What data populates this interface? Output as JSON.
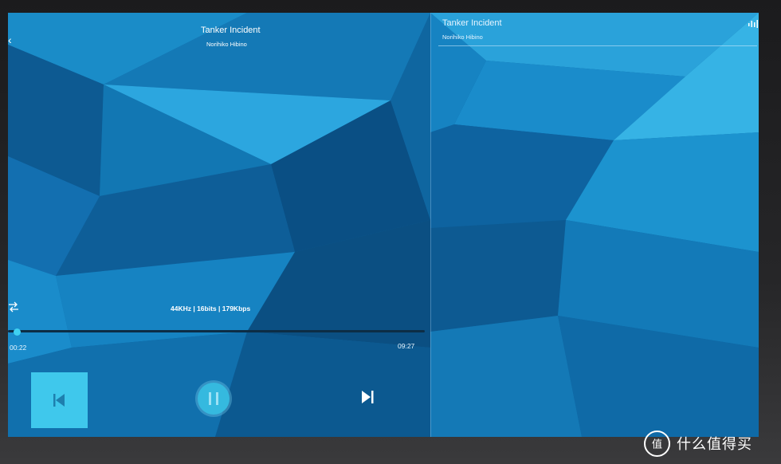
{
  "player": {
    "left_pane": {
      "track_title": "Tanker Incident",
      "artist": "Norihiko Hibino"
    },
    "right_pane": {
      "track_title": "Tanker Incident",
      "artist": "Norihiko Hibino"
    },
    "audio_info": "44KHz | 16bits | 179Kbps",
    "progress": {
      "elapsed": "00:22",
      "total": "09:27",
      "fraction": 0.039
    },
    "icons": {
      "back": "back-arrow-icon",
      "shuffle": "repeat-icon",
      "equalizer": "equalizer-icon",
      "previous": "skip-previous-icon",
      "pause": "pause-icon",
      "next": "skip-next-icon"
    },
    "colors": {
      "accent": "#3fc8ec",
      "background": "#10649a"
    }
  },
  "watermark": {
    "logo_text": "值",
    "text": "什么值得买"
  }
}
